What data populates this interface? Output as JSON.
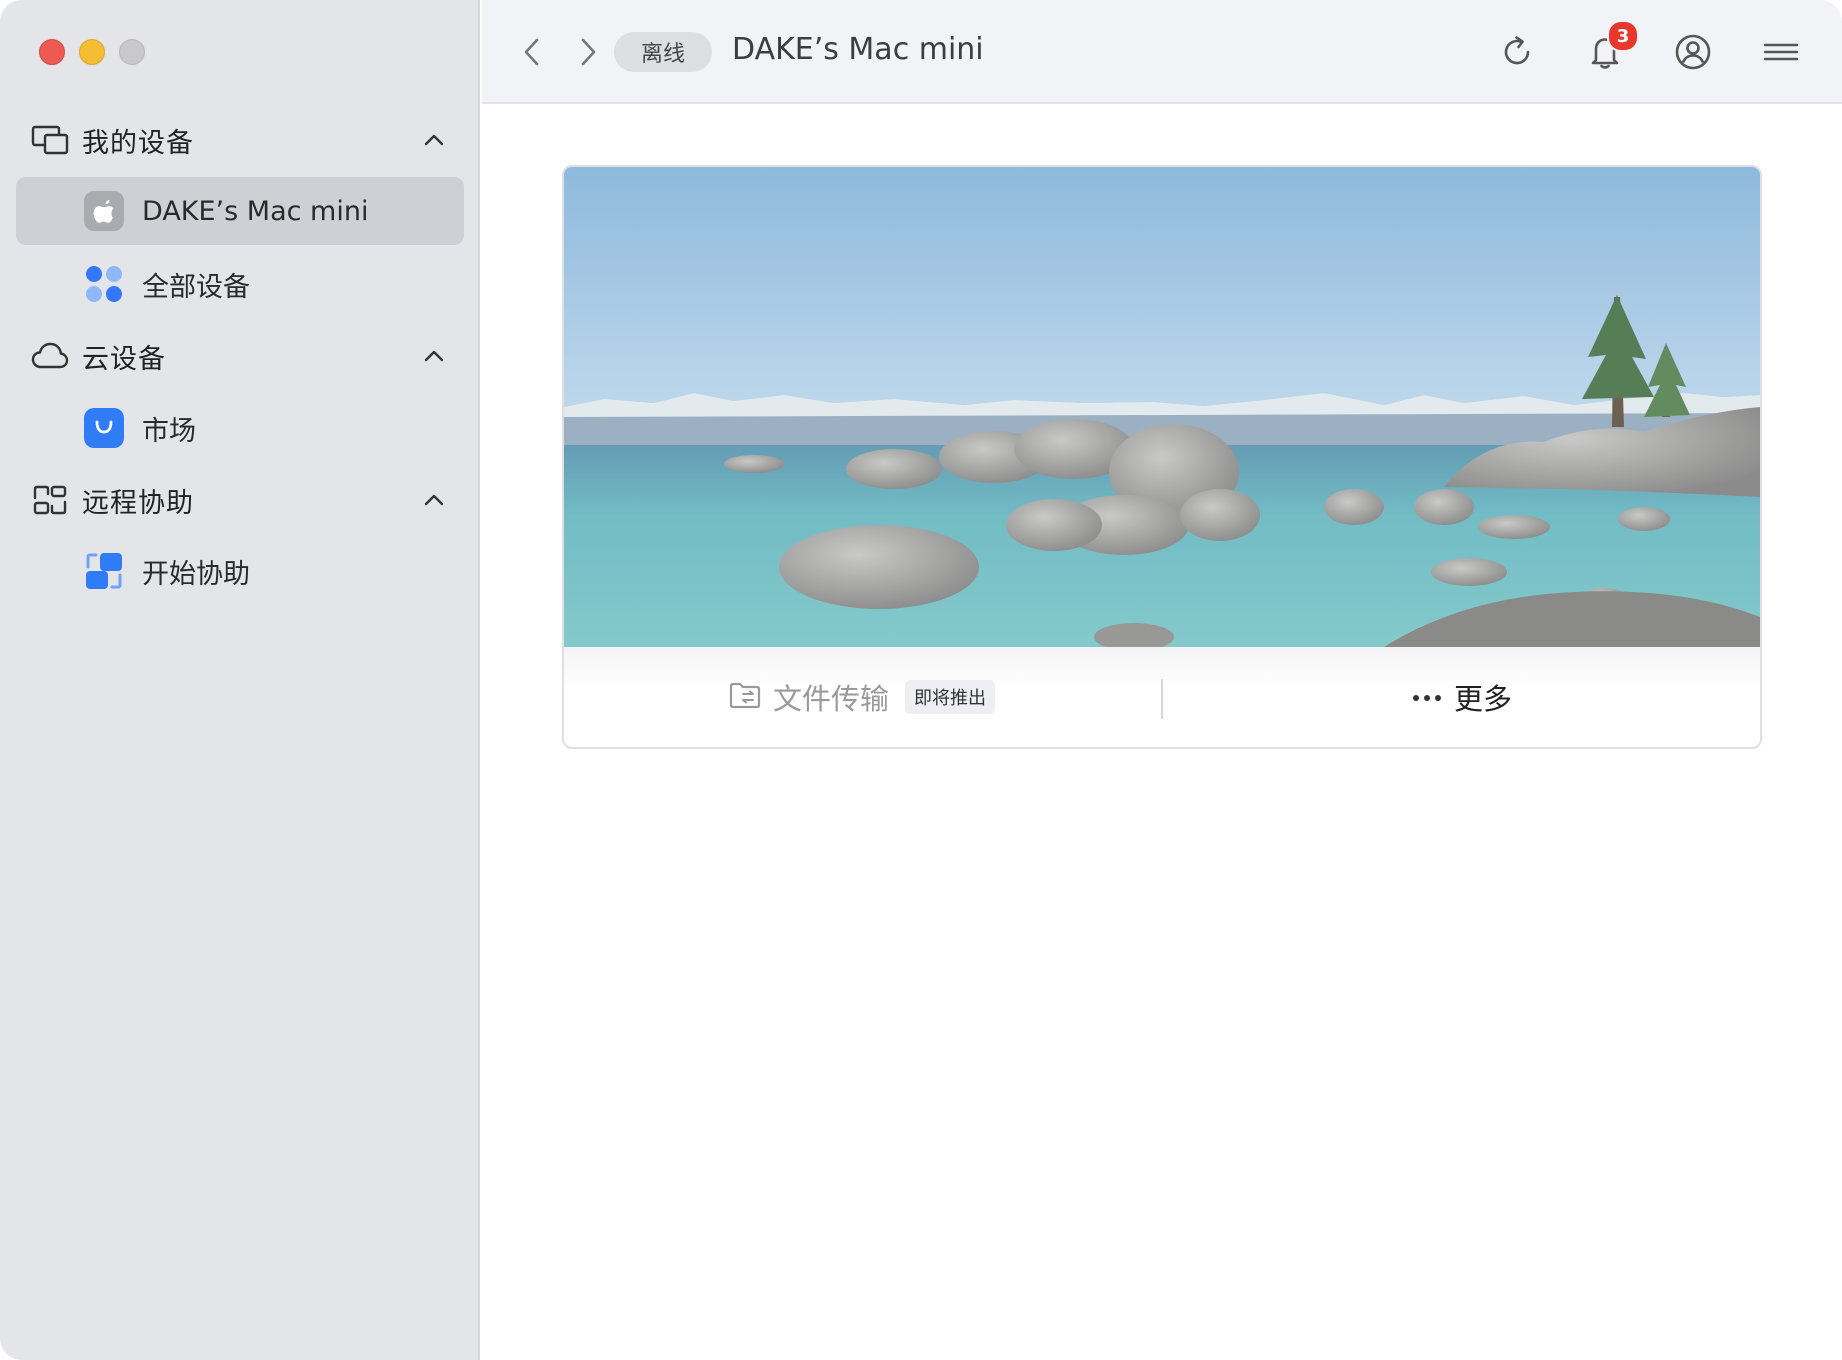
{
  "sidebar": {
    "sections": [
      {
        "label": "我的设备",
        "icon": "devices-icon",
        "items": [
          {
            "label": "DAKE’s Mac mini",
            "icon": "apple-logo-icon",
            "active": true
          },
          {
            "label": "全部设备",
            "icon": "all-devices-grid-icon",
            "active": false
          }
        ]
      },
      {
        "label": "云设备",
        "icon": "cloud-icon",
        "items": [
          {
            "label": "市场",
            "icon": "market-bag-icon",
            "active": false
          }
        ]
      },
      {
        "label": "远程协助",
        "icon": "remote-assist-icon",
        "items": [
          {
            "label": "开始协助",
            "icon": "start-assist-icon",
            "active": false
          }
        ]
      }
    ]
  },
  "toolbar": {
    "status": "离线",
    "device_name": "DAKE’s Mac mini",
    "notification_count": "3"
  },
  "card": {
    "file_transfer_label": "文件传输",
    "coming_soon_tag": "即将推出",
    "more_label": "更多"
  },
  "colors": {
    "accent_blue": "#2f7cf6",
    "badge_red": "#e8382c",
    "sidebar_bg": "#e4e5e9",
    "selected_bg": "#cfd0d5"
  }
}
